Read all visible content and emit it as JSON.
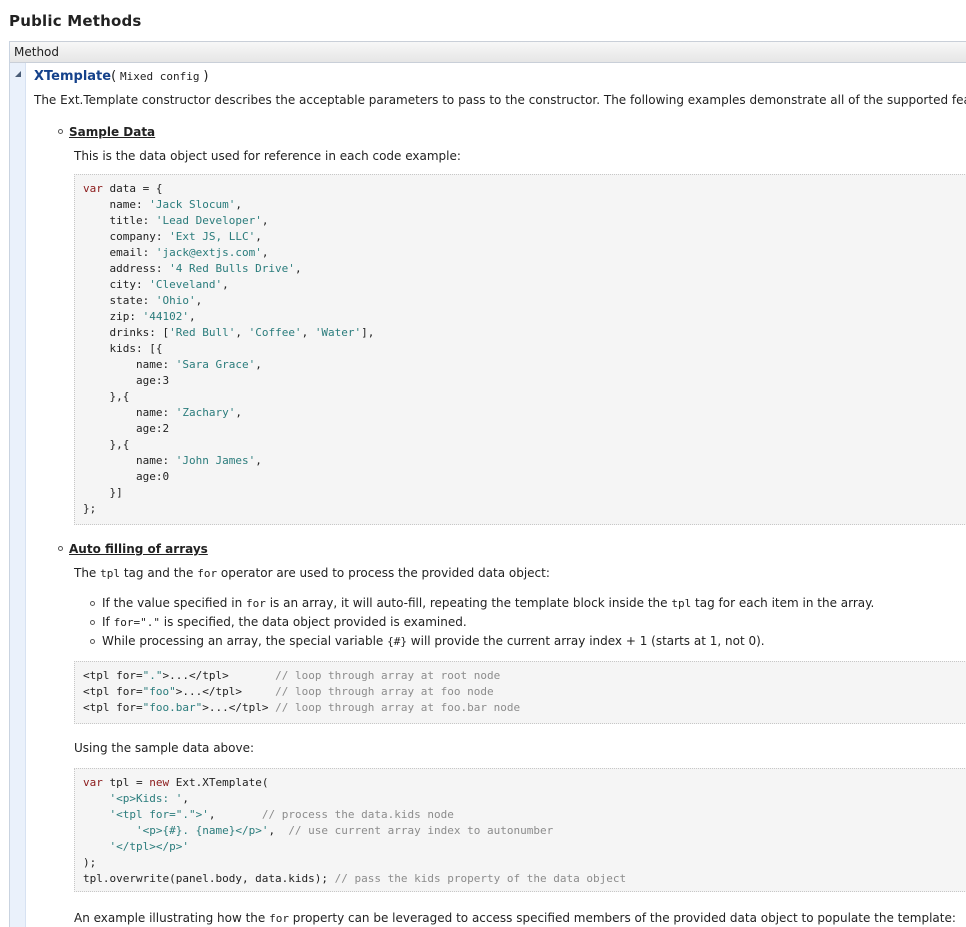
{
  "section_title": "Public Methods",
  "table_header": "Method",
  "method": {
    "name": "XTemplate",
    "open_paren": "(",
    "params": "Mixed config",
    "close_paren": ")",
    "description": "The Ext.Template constructor describes the acceptable parameters to pass to the constructor. The following examples demonstrate all of the supported features."
  },
  "sample_data": {
    "heading": "Sample Data",
    "intro": "This is the data object used for reference in each code example:"
  },
  "auto_filling": {
    "heading": "Auto filling of arrays",
    "intro_pre": "The ",
    "intro_tpl": "tpl",
    "intro_mid": " tag and the ",
    "intro_for": "for",
    "intro_post": " operator are used to process the provided data object:",
    "items": [
      {
        "a": "If the value specified in ",
        "b": "for",
        "c": " is an array, it will auto-fill, repeating the template block inside the ",
        "d": "tpl",
        "e": " tag for each item in the array."
      },
      {
        "a": "If ",
        "b": "for=\".\"",
        "c": " is specified, the data object provided is examined.",
        "d": "",
        "e": ""
      },
      {
        "a": "While processing an array, the special variable ",
        "b": "{#}",
        "c": " will provide the current array index + 1 (starts at 1, not 0).",
        "d": "",
        "e": ""
      }
    ],
    "using_text": "Using the sample data above:",
    "example_pre": "An example illustrating how the ",
    "example_for": "for",
    "example_post": " property can be leveraged to access specified members of the provided data object to populate the template:"
  },
  "code_blocks": {
    "sample": [
      "var data = {",
      "    name: 'Jack Slocum',",
      "    title: 'Lead Developer',",
      "    company: 'Ext JS, LLC',",
      "    email: 'jack@extjs.com',",
      "    address: '4 Red Bulls Drive',",
      "    city: 'Cleveland',",
      "    state: 'Ohio',",
      "    zip: '44102',",
      "    drinks: ['Red Bull', 'Coffee', 'Water'],",
      "    kids: [{",
      "        name: 'Sara Grace',",
      "        age:3",
      "    },{",
      "        name: 'Zachary',",
      "        age:2",
      "    },{",
      "        name: 'John James',",
      "        age:0",
      "    }]",
      "};"
    ],
    "tpl_loop": [
      "<tpl for=\".\">...</tpl>       // loop through array at root node",
      "<tpl for=\"foo\">...</tpl>     // loop through array at foo node",
      "<tpl for=\"foo.bar\">...</tpl> // loop through array at foo.bar node"
    ],
    "usage": [
      "var tpl = new Ext.XTemplate(",
      "    '<p>Kids: ',",
      "    '<tpl for=\".\">',       // process the data.kids node",
      "        '<p>{#}. {name}</p>',  // use current array index to autonumber",
      "    '</tpl></p>'",
      ");",
      "tpl.overwrite(panel.body, data.kids); // pass the kids property of the data object"
    ]
  },
  "colors": {
    "method_name": "#15428b",
    "keyword": "#8b1a1a",
    "string": "#2a7c7c",
    "comment": "#8c8c8c",
    "code_bg": "#f5f5f5"
  }
}
